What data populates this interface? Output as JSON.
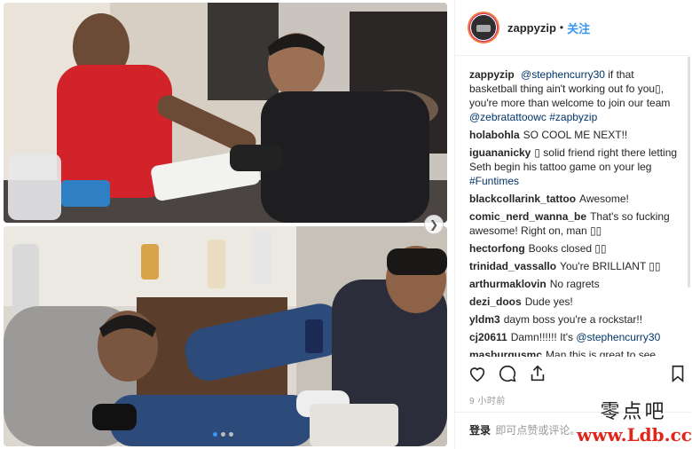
{
  "header": {
    "username": "zappyzip",
    "separator": "•",
    "follow_label": "关注"
  },
  "caption": {
    "user": "zappyzip",
    "parts": [
      {
        "text": "@stephencurry30",
        "link": true
      },
      {
        "text": " if that basketball thing ain't working out fo you▯, you're more than welcome to join our team ",
        "link": false
      },
      {
        "text": "@zebratattoowc",
        "link": true
      },
      {
        "text": " ",
        "link": false
      },
      {
        "text": "#zapbyzip",
        "link": true
      }
    ]
  },
  "comments": [
    {
      "user": "holabohla",
      "parts": [
        {
          "text": "SO COOL ME NEXT!!",
          "link": false
        }
      ]
    },
    {
      "user": "iguananicky",
      "parts": [
        {
          "text": "▯ solid friend right there letting Seth begin his tattoo game on your leg ",
          "link": false
        },
        {
          "text": "#Funtimes",
          "link": true
        }
      ]
    },
    {
      "user": "blackcollarink_tattoo",
      "parts": [
        {
          "text": "Awesome!",
          "link": false
        }
      ]
    },
    {
      "user": "comic_nerd_wanna_be",
      "parts": [
        {
          "text": "That's so fucking awesome! Right on, man ▯▯",
          "link": false
        }
      ]
    },
    {
      "user": "hectorfong",
      "parts": [
        {
          "text": "Books closed ▯▯",
          "link": false
        }
      ]
    },
    {
      "user": "trinidad_vassallo",
      "parts": [
        {
          "text": "You're BRILLIANT ▯▯",
          "link": false
        }
      ]
    },
    {
      "user": "arthurmaklovin",
      "parts": [
        {
          "text": "No ragrets",
          "link": false
        }
      ]
    },
    {
      "user": "dezi_doos",
      "parts": [
        {
          "text": "Dude yes!",
          "link": false
        }
      ]
    },
    {
      "user": "yldm3",
      "parts": [
        {
          "text": "daym boss you're a rockstar!!",
          "link": false
        }
      ]
    },
    {
      "user": "cj20611",
      "parts": [
        {
          "text": "Damn!!!!!! It's ",
          "link": false
        },
        {
          "text": "@stephencurry30",
          "link": true
        }
      ]
    },
    {
      "user": "masburgusmc",
      "parts": [
        {
          "text": "Man this is great to see,",
          "link": false
        }
      ]
    }
  ],
  "timestamp": "9 小时前",
  "login": {
    "link_label": "登录",
    "suffix": "即可点赞或评论。"
  },
  "icons": [
    "heart-icon",
    "comment-icon",
    "share-icon",
    "bookmark-icon",
    "chevron-right-icon"
  ],
  "carousel": {
    "count": 3,
    "active": 0
  },
  "watermark": {
    "top": "零点吧",
    "bottom": "www.Ldb.cc"
  },
  "colors": {
    "link": "#003569",
    "follow": "#3897f0",
    "muted": "#999999",
    "watermark_red": "#e0251b"
  }
}
